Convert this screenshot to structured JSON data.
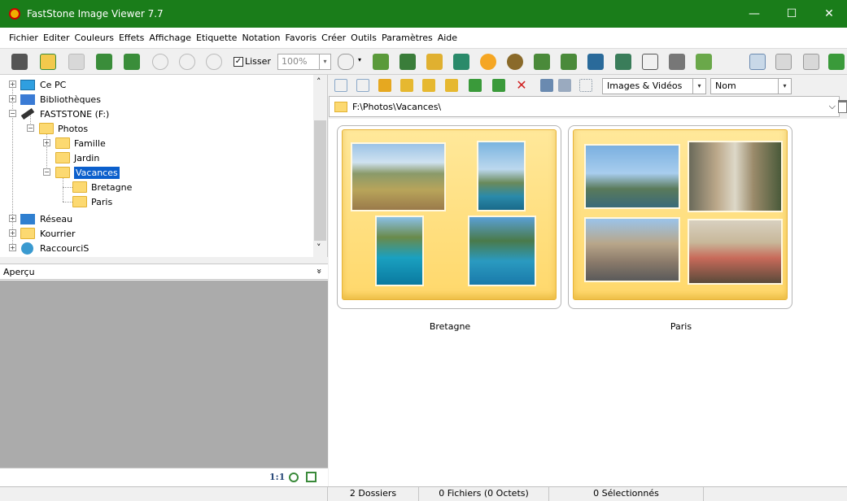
{
  "window": {
    "title": "FastStone Image Viewer 7.7",
    "minimize": "—",
    "maximize": "☐",
    "close": "✕"
  },
  "menu": [
    "Fichier",
    "Editer",
    "Couleurs",
    "Effets",
    "Affichage",
    "Etiquette",
    "Notation",
    "Favoris",
    "Créer",
    "Outils",
    "Paramètres",
    "Aide"
  ],
  "toolbar": {
    "smooth_label": "Lisser",
    "smooth_checked": "✓",
    "zoom_value": "100%",
    "zoom_arrow": "▾",
    "hand_arrow": "▾"
  },
  "tree": {
    "nodes": [
      "Ce PC",
      "Bibliothèques",
      "FASTSTONE (F:)",
      "Photos",
      "Famille",
      "Jardin",
      "Vacances",
      "Bretagne",
      "Paris",
      "Réseau",
      "Kourrier",
      "RaccourciS"
    ],
    "selected": "Vacances",
    "scroll_up": "˄",
    "scroll_down": "˅"
  },
  "preview": {
    "label": "Aperçu",
    "collapse": "»",
    "ratio": "1:1"
  },
  "browser": {
    "filter": "Images & Vidéos",
    "sort": "Nom",
    "path": "F:\\Photos\\Vacances\\",
    "path_dropdown": "⌵"
  },
  "folders": [
    {
      "name": "Bretagne"
    },
    {
      "name": "Paris"
    }
  ],
  "status": {
    "folders": "2 Dossiers",
    "files": "0 Fichiers (0 Octets)",
    "selected": "0 Sélectionnés"
  },
  "colors": {
    "titlebar": "#1a7d1a",
    "selection": "#0b5fcc",
    "folder": "#fcd971"
  }
}
